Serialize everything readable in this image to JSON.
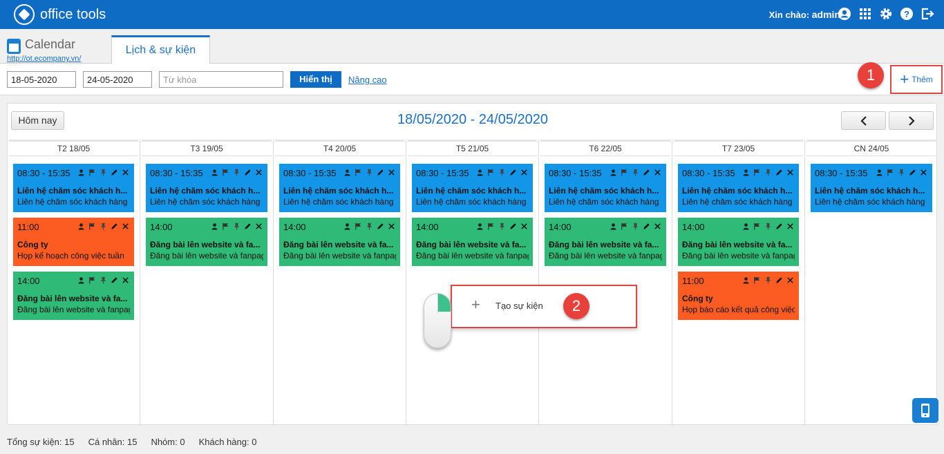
{
  "brand": {
    "name": "office tools"
  },
  "header": {
    "greeting_label": "Xin chào:",
    "username": "admin"
  },
  "app": {
    "title": "Calendar",
    "url": "http://ot.ecompany.vn/"
  },
  "tabs": [
    {
      "label": "Lịch & sự kiện"
    }
  ],
  "filters": {
    "from_date": "18-05-2020",
    "to_date": "24-05-2020",
    "keyword_placeholder": "Từ khóa",
    "show_label": "Hiển thị",
    "advanced_label": "Nâng cao",
    "add_label": "Thêm"
  },
  "markers": [
    "1",
    "2"
  ],
  "calendar": {
    "today_label": "Hôm nay",
    "range_title": "18/05/2020 - 24/05/2020",
    "days": [
      {
        "label": "T2 18/05",
        "events": [
          {
            "color": "#1496e8",
            "time": "08:30 - 15:35",
            "title": "Liên hệ chăm sóc khách h...",
            "desc": "Liên hệ chăm sóc khách hàng"
          },
          {
            "color": "#fc5b22",
            "time": "11:00",
            "title": "Công ty",
            "desc": "Họp kế hoạch công việc tuần"
          },
          {
            "color": "#2fba78",
            "time": "14:00",
            "title": "Đăng bài lên website và fa...",
            "desc": "Đăng bài lên website và fanpag"
          }
        ]
      },
      {
        "label": "T3 19/05",
        "events": [
          {
            "color": "#1496e8",
            "time": "08:30 - 15:35",
            "title": "Liên hệ chăm sóc khách h...",
            "desc": "Liên hệ chăm sóc khách hàng"
          },
          {
            "color": "#2fba78",
            "time": "14:00",
            "title": "Đăng bài lên website và fa...",
            "desc": "Đăng bài lên website và fanpag"
          }
        ]
      },
      {
        "label": "T4 20/05",
        "events": [
          {
            "color": "#1496e8",
            "time": "08:30 - 15:35",
            "title": "Liên hệ chăm sóc khách h...",
            "desc": "Liên hệ chăm sóc khách hàng"
          },
          {
            "color": "#2fba78",
            "time": "14:00",
            "title": "Đăng bài lên website và fa...",
            "desc": "Đăng bài lên website và fanpag"
          }
        ]
      },
      {
        "label": "T5 21/05",
        "events": [
          {
            "color": "#1496e8",
            "time": "08:30 - 15:35",
            "title": "Liên hệ chăm sóc khách h...",
            "desc": "Liên hệ chăm sóc khách hàng"
          },
          {
            "color": "#2fba78",
            "time": "14:00",
            "title": "Đăng bài lên website và fa...",
            "desc": "Đăng bài lên website và fanpag"
          }
        ]
      },
      {
        "label": "T6 22/05",
        "events": [
          {
            "color": "#1496e8",
            "time": "08:30 - 15:35",
            "title": "Liên hệ chăm sóc khách h...",
            "desc": "Liên hệ chăm sóc khách hàng"
          },
          {
            "color": "#2fba78",
            "time": "14:00",
            "title": "Đăng bài lên website và fa...",
            "desc": "Đăng bài lên website và fanpag"
          }
        ]
      },
      {
        "label": "T7 23/05",
        "events": [
          {
            "color": "#1496e8",
            "time": "08:30 - 15:35",
            "title": "Liên hệ chăm sóc khách h...",
            "desc": "Liên hệ chăm sóc khách hàng"
          },
          {
            "color": "#2fba78",
            "time": "14:00",
            "title": "Đăng bài lên website và fa...",
            "desc": "Đăng bài lên website và fanpag"
          },
          {
            "color": "#fc5b22",
            "time": "11:00",
            "title": "Công ty",
            "desc": "Họp báo cáo kết quả công việc"
          }
        ]
      },
      {
        "label": "CN 24/05",
        "events": [
          {
            "color": "#1496e8",
            "time": "08:30 - 15:35",
            "title": "Liên hệ chăm sóc khách h...",
            "desc": "Liên hệ chăm sóc khách hàng"
          }
        ]
      }
    ]
  },
  "context_menu": {
    "item_label": "Tạo sự kiện"
  },
  "footer": {
    "total": "Tổng sự kiện: 15",
    "personal": "Cá nhân: 15",
    "group": "Nhóm: 0",
    "customer": "Khách hàng: 0"
  }
}
